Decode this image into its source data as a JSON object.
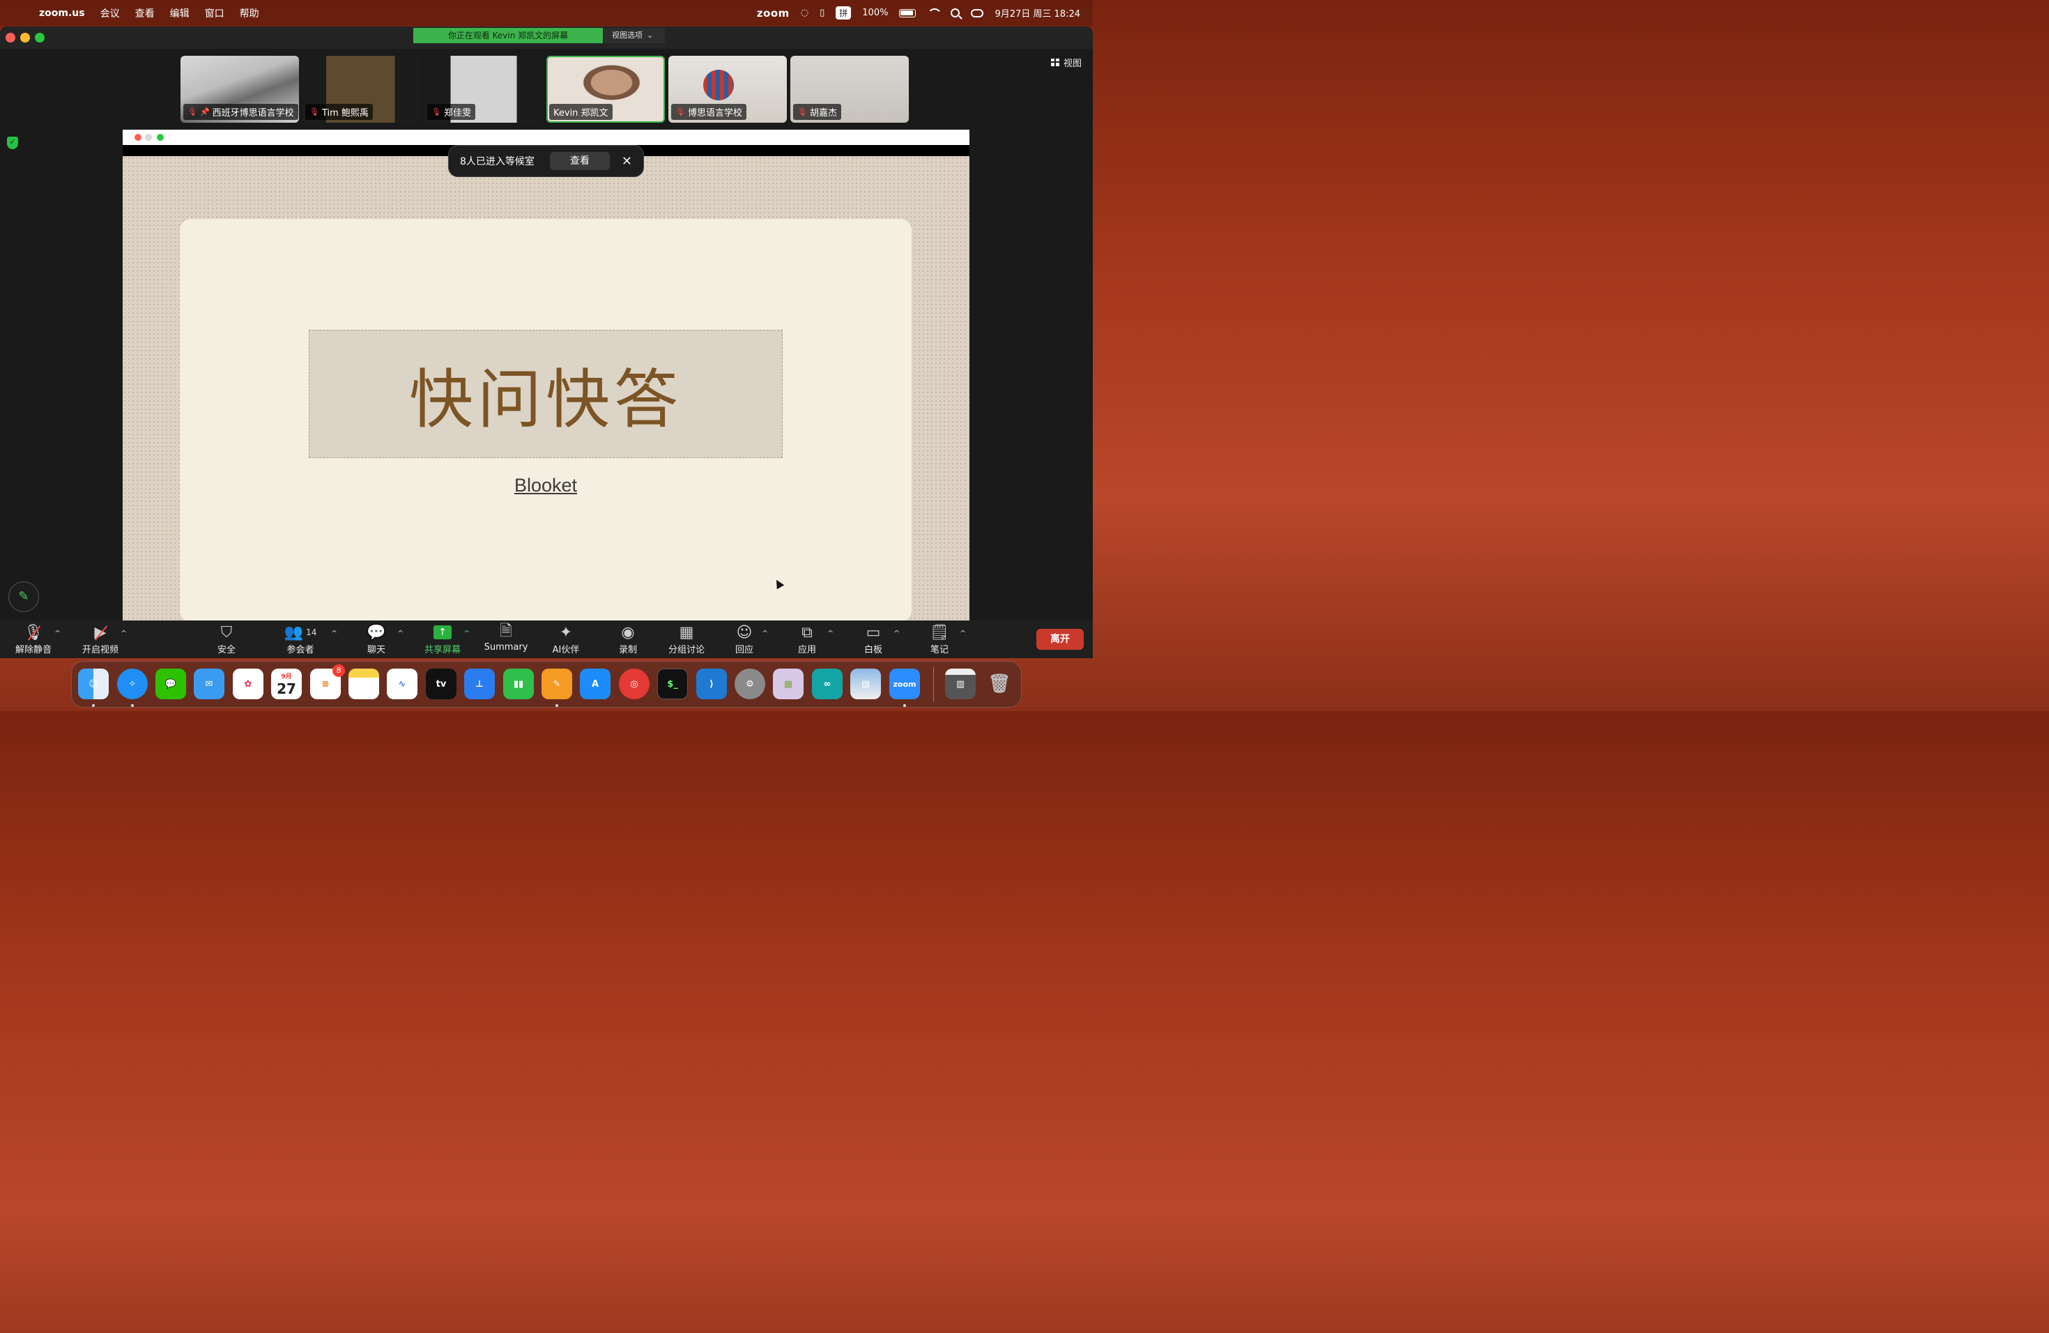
{
  "menubar": {
    "app_name": "zoom.us",
    "menus": [
      "会议",
      "查看",
      "编辑",
      "窗口",
      "帮助"
    ],
    "zoom_logo": "zoom",
    "ime": "拼",
    "battery": "100%",
    "datetime": "9月27日 周三  18:24"
  },
  "window": {
    "viewing_banner": "你正在观看 Kevin 郑凯文的屏幕",
    "view_options": "视图选项",
    "view_button": "视图"
  },
  "participants": [
    {
      "name": "西班牙博思语言学校",
      "muted": true,
      "pinned": true
    },
    {
      "name": "Tim 鲍熙禹",
      "muted": true,
      "pinned": false
    },
    {
      "name": "郑佳雯",
      "muted": true,
      "pinned": false
    },
    {
      "name": "Kevin 郑凯文",
      "muted": false,
      "pinned": false,
      "active": true
    },
    {
      "name": "博思语言学校",
      "muted": true,
      "pinned": false
    },
    {
      "name": "胡嘉杰",
      "muted": true,
      "pinned": false
    }
  ],
  "waiting_room": {
    "message": "8人已进入等候室",
    "view_label": "查看",
    "close": "✕"
  },
  "slide": {
    "title": "快问快答",
    "link": "Blooket"
  },
  "toolbar": {
    "unmute": "解除静音",
    "start_video": "开启视频",
    "security": "安全",
    "participants": "参会者",
    "participants_count": "14",
    "chat": "聊天",
    "share_screen": "共享屏幕",
    "summary": "Summary",
    "ai_companion": "AI伙伴",
    "record": "录制",
    "breakout": "分组讨论",
    "reactions": "回应",
    "apps": "应用",
    "whiteboard": "白板",
    "notes": "笔记",
    "leave": "离开"
  },
  "dock": {
    "calendar_month": "9月",
    "calendar_day": "27",
    "reminders_badge": "8",
    "zoom_label": "zoom",
    "tv_label": "tv"
  },
  "colors": {
    "accent_green": "#3db34b",
    "leave_red": "#c93a2d",
    "slide_title": "#7c5425"
  }
}
